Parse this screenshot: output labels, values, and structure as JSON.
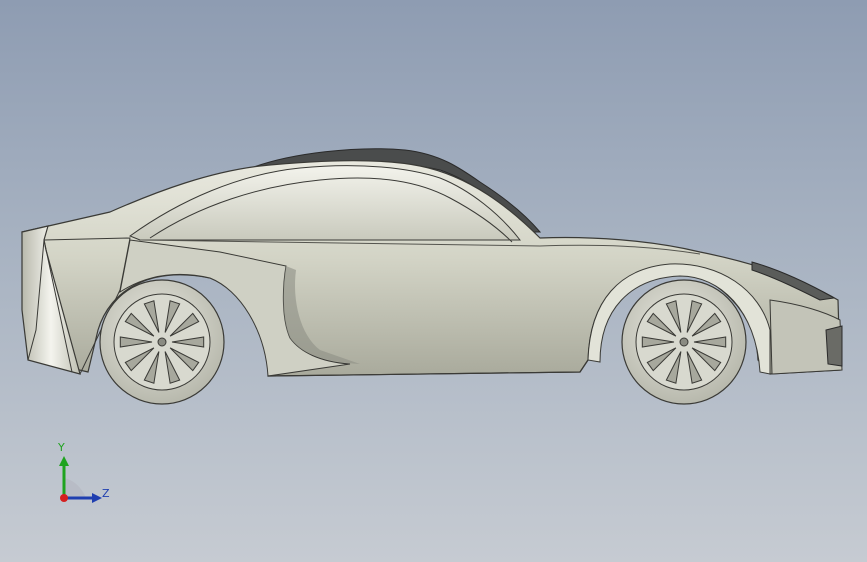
{
  "viewport": {
    "model": "car-body",
    "view": "right-side",
    "background_top": "#8e9cb2",
    "background_bottom": "#c6cbd2"
  },
  "triad": {
    "y_label": "Y",
    "z_label": "Z",
    "y_color": "#1fa31f",
    "z_color": "#1f3fb0",
    "x_color": "#d42020"
  }
}
